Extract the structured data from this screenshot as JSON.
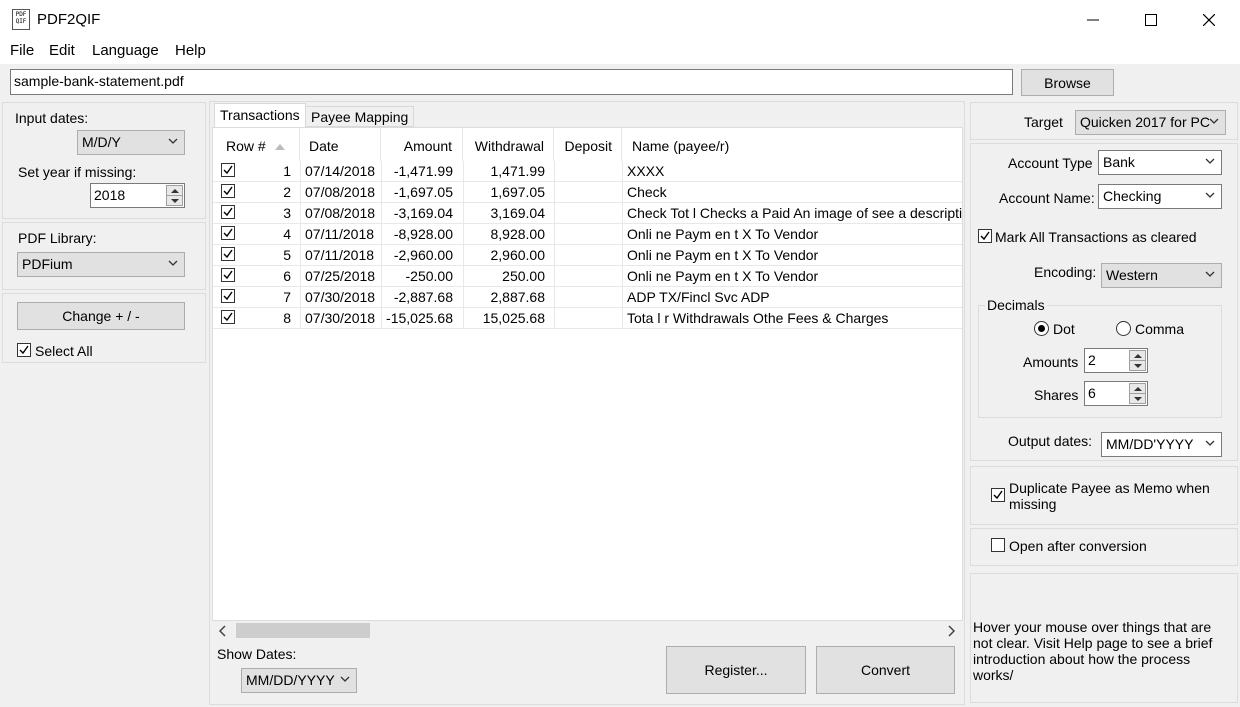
{
  "window": {
    "title": "PDF2QIF",
    "icon_text_top": "PDF",
    "icon_text_bottom": "QIF"
  },
  "menu": [
    "File",
    "Edit",
    "Language",
    "Help"
  ],
  "file": {
    "path": "sample-bank-statement.pdf",
    "browse_label": "Browse"
  },
  "left": {
    "input_dates_label": "Input dates:",
    "input_dates_value": "M/D/Y",
    "year_label": "Set year if missing:",
    "year_value": "2018",
    "pdf_library_label": "PDF Library:",
    "pdf_library_value": "PDFium",
    "change_sign_label": "Change + / -",
    "select_all_label": "Select All"
  },
  "tabs": [
    "Transactions",
    "Payee Mapping"
  ],
  "table": {
    "columns": [
      "Row #",
      "Date",
      "Amount",
      "Withdrawal",
      "Deposit",
      "Name (payee/r)"
    ],
    "rows": [
      {
        "n": "1",
        "date": "07/14/2018",
        "amount": "-1,471.99",
        "withdrawal": "1,471.99",
        "deposit": "",
        "name": "XXXX"
      },
      {
        "n": "2",
        "date": "07/08/2018",
        "amount": "-1,697.05",
        "withdrawal": "1,697.05",
        "deposit": "",
        "name": "Check"
      },
      {
        "n": "3",
        "date": "07/08/2018",
        "amount": "-3,169.04",
        "withdrawal": "3,169.04",
        "deposit": "",
        "name": "Check Tot l Checks a Paid An image of see a description"
      },
      {
        "n": "4",
        "date": "07/11/2018",
        "amount": "-8,928.00",
        "withdrawal": "8,928.00",
        "deposit": "",
        "name": "Onli ne Paym en t X To Vendor"
      },
      {
        "n": "5",
        "date": "07/11/2018",
        "amount": "-2,960.00",
        "withdrawal": "2,960.00",
        "deposit": "",
        "name": "Onli ne Paym en t X To Vendor"
      },
      {
        "n": "6",
        "date": "07/25/2018",
        "amount": "-250.00",
        "withdrawal": "250.00",
        "deposit": "",
        "name": "Onli ne Paym en t X To Vendor"
      },
      {
        "n": "7",
        "date": "07/30/2018",
        "amount": "-2,887.68",
        "withdrawal": "2,887.68",
        "deposit": "",
        "name": "ADP TX/Fincl Svc ADP"
      },
      {
        "n": "8",
        "date": "07/30/2018",
        "amount": "-15,025.68",
        "withdrawal": "15,025.68",
        "deposit": "",
        "name": "Tota l r Withdrawals Othe Fees & Charges"
      }
    ]
  },
  "bottom": {
    "show_dates_label": "Show Dates:",
    "show_dates_value": "MM/DD/YYYY",
    "register_label": "Register...",
    "convert_label": "Convert"
  },
  "right": {
    "target_label": "Target",
    "target_value": "Quicken 2017 for PC",
    "account_type_label": "Account Type",
    "account_type_value": "Bank",
    "account_name_label": "Account Name:",
    "account_name_value": "Checking",
    "mark_cleared_label": "Mark All Transactions as cleared",
    "encoding_label": "Encoding:",
    "encoding_value": "Western",
    "decimals_label": "Decimals",
    "dot_label": "Dot",
    "comma_label": "Comma",
    "amounts_label": "Amounts",
    "amounts_value": "2",
    "shares_label": "Shares",
    "shares_value": "6",
    "output_dates_label": "Output dates:",
    "output_dates_value": "MM/DD'YYYY",
    "duplicate_payee_label": "Duplicate Payee as Memo when missing",
    "open_after_label": "Open after conversion",
    "help_text": "Hover your mouse over things that are not clear. Visit Help page to see a brief introduction about how the process works/"
  }
}
